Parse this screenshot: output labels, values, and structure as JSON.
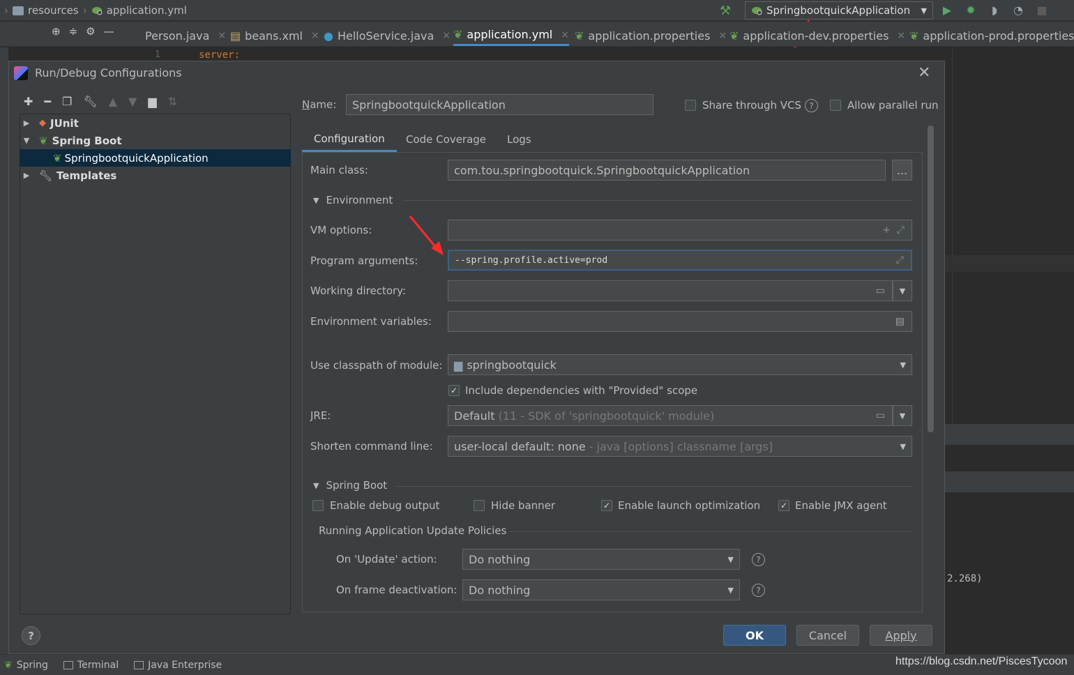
{
  "breadcrumb": {
    "folder": "resources",
    "file": "application.yml"
  },
  "run_config": {
    "selected": "SpringbootquickApplication"
  },
  "editor_tabs": [
    {
      "label": "Person.java"
    },
    {
      "label": "beans.xml"
    },
    {
      "label": "HelloService.java"
    },
    {
      "label": "application.yml"
    },
    {
      "label": "application.properties"
    },
    {
      "label": "application-dev.properties"
    },
    {
      "label": "application-prod.properties"
    }
  ],
  "editor": {
    "line_number": "1",
    "code": "server:"
  },
  "console": {
    "text": "2.268)"
  },
  "dialog": {
    "title": "Run/Debug Configurations",
    "tree": {
      "junit": "JUnit",
      "spring_boot": "Spring Boot",
      "app": "SpringbootquickApplication",
      "templates": "Templates"
    },
    "name_label": "Name:",
    "name_value": "SpringbootquickApplication",
    "share_vcs": "Share through VCS",
    "allow_parallel": "Allow parallel run",
    "tabs": [
      "Configuration",
      "Code Coverage",
      "Logs"
    ],
    "main_class_label": "Main class:",
    "main_class_value": "com.tou.springbootquick.SpringbootquickApplication",
    "browse_label": "...",
    "environment_section": "Environment",
    "vm_options_label": "VM options:",
    "program_args_label": "Program arguments:",
    "program_args_value": "--spring.profile.active=prod",
    "working_dir_label": "Working directory:",
    "env_vars_label": "Environment variables:",
    "classpath_label": "Use classpath of module:",
    "classpath_value": "springbootquick",
    "include_deps": "Include dependencies with \"Provided\" scope",
    "jre_label": "JRE:",
    "jre_value": "Default",
    "jre_hint": "(11 - SDK of 'springbootquick' module)",
    "shorten_label": "Shorten command line:",
    "shorten_value": "user-local default: none",
    "shorten_hint": "- java [options] classname [args]",
    "spring_boot_section": "Spring Boot",
    "enable_debug": "Enable debug output",
    "hide_banner": "Hide banner",
    "enable_launch_opt": "Enable launch optimization",
    "enable_jmx": "Enable JMX agent",
    "update_policies": "Running Application Update Policies",
    "on_update_label": "On 'Update' action:",
    "on_update_value": "Do nothing",
    "on_frame_label": "On frame deactivation:",
    "on_frame_value": "Do nothing",
    "ok": "OK",
    "cancel": "Cancel",
    "apply": "Apply"
  },
  "statusbar": {
    "spring": "Spring",
    "terminal": "Terminal",
    "java_ee": "Java Enterprise"
  },
  "watermark": "https://blog.csdn.net/PiscesTycoon",
  "colors": {
    "accent": "#4a88c7",
    "selection": "#0d293e",
    "annotation_arrow": "#ff2a2a"
  }
}
